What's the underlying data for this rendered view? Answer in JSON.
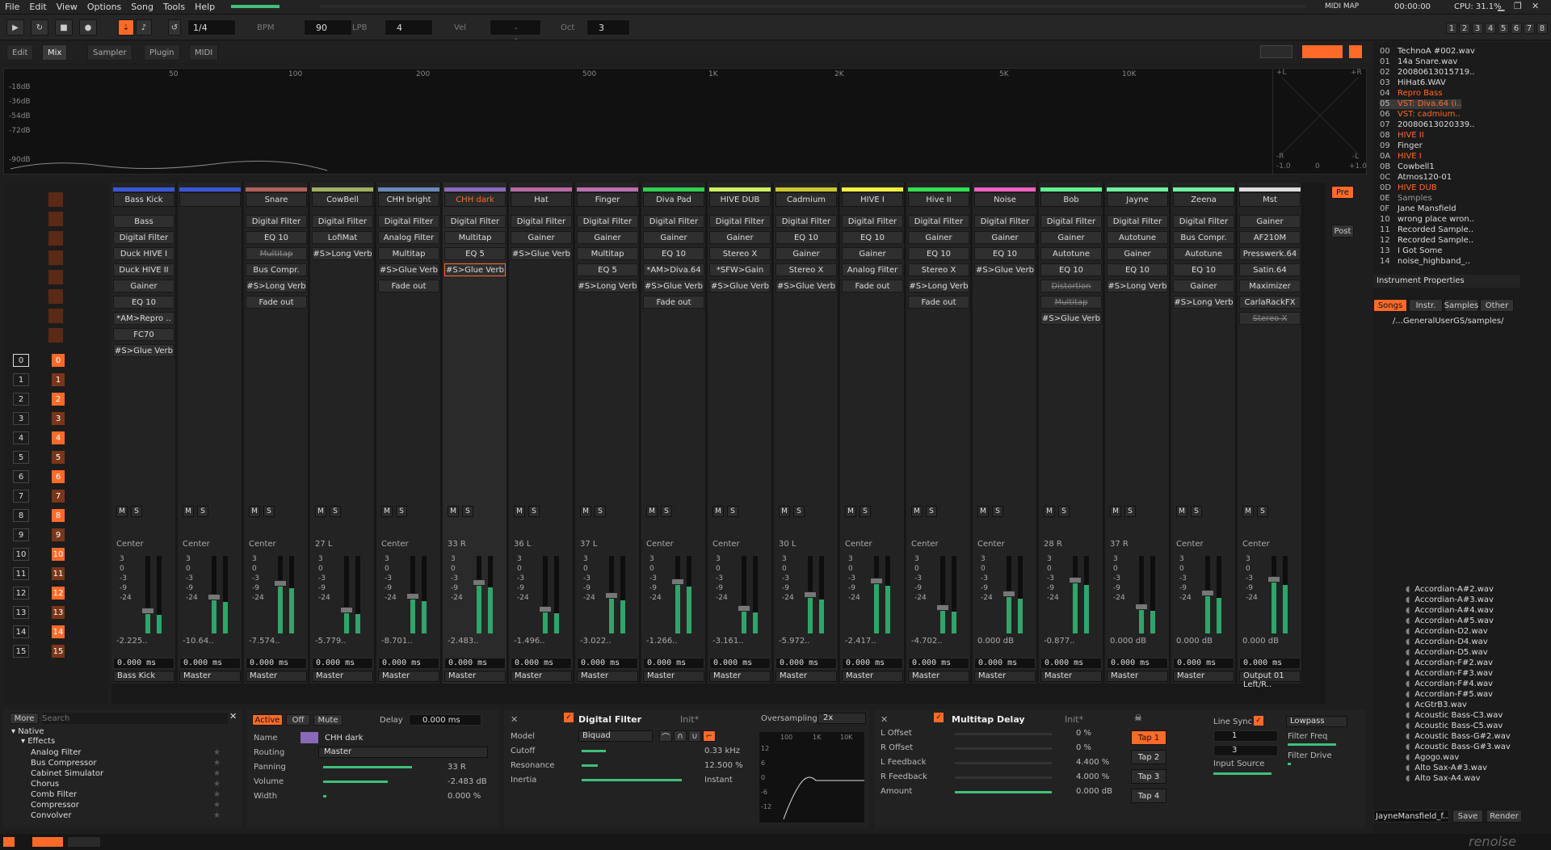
{
  "menu": [
    "File",
    "Edit",
    "View",
    "Options",
    "Song",
    "Tools",
    "Help"
  ],
  "status": {
    "midi_map": "MIDI MAP",
    "time": "00:00:00",
    "cpu": "CPU: 31.1%"
  },
  "transport": {
    "pattern": "1/4",
    "bpm_label": "BPM",
    "bpm": "90",
    "lpb_label": "LPB",
    "lpb": "4",
    "vel_label": "Vel",
    "vel": "--",
    "oct_label": "Oct",
    "oct": "3"
  },
  "tabs": {
    "edit": "Edit",
    "mix": "Mix",
    "sampler": "Sampler",
    "plugin": "Plugin",
    "midi": "MIDI"
  },
  "spectrum": {
    "db": [
      "-18dB",
      "-36dB",
      "-54dB",
      "-72dB",
      "-90dB"
    ],
    "freq": [
      "50",
      "100",
      "200",
      "500",
      "1K",
      "2K",
      "5K",
      "10K"
    ],
    "scope_left": "+L",
    "scope_right": "+R",
    "scope_r": "-R",
    "scope_l": "-L",
    "scope_min": "-1.0",
    "scope_zero": "0",
    "scope_max": "+1.0"
  },
  "mixer": {
    "strips": [
      {
        "name": "Bass Kick",
        "color": "#3a56d8",
        "devices": [
          "Bass",
          "Digital Filter",
          "Duck HIVE I",
          "Duck HIVE II",
          "Gainer",
          "EQ 10",
          "*AM>Repro ..",
          "FC70",
          "#S>Glue Verb"
        ],
        "pan": "Center",
        "vol": "-2.225..",
        "delay": "0.000 ms",
        "route": "Bass Kick"
      },
      {
        "name": "",
        "color": "#3a56d8",
        "devices": [],
        "pan": "Center",
        "vol": "-10.64..",
        "delay": "0.000 ms",
        "route": "Master"
      },
      {
        "name": "Snare",
        "color": "#b0605a",
        "devices": [
          "Digital Filter",
          "EQ 10",
          "Multitap",
          "Bus Compr.",
          "#S>Long Verb",
          "Fade out"
        ],
        "pan": "Center",
        "vol": "-7.574..",
        "delay": "0.000 ms",
        "route": "Master"
      },
      {
        "name": "CowBell",
        "color": "#a0b060",
        "devices": [
          "Digital Filter",
          "LofiMat",
          "#S>Long Verb"
        ],
        "pan": "27 L",
        "vol": "-5.779..",
        "delay": "0.000 ms",
        "route": "Master"
      },
      {
        "name": "CHH bright",
        "color": "#6a8ab8",
        "devices": [
          "Digital Filter",
          "Analog Filter",
          "Multitap",
          "#S>Glue Verb",
          "Fade out"
        ],
        "pan": "Center",
        "vol": "-8.701..",
        "delay": "0.000 ms",
        "route": "Master"
      },
      {
        "name": "CHH dark",
        "color": "#8a6ab8",
        "devices": [
          "Digital Filter",
          "Multitap",
          "EQ 5",
          "#S>Glue Verb"
        ],
        "pan": "33 R",
        "vol": "-2.483..",
        "delay": "0.000 ms",
        "route": "Master"
      },
      {
        "name": "Hat",
        "color": "#b86aa0",
        "devices": [
          "Digital Filter",
          "Gainer",
          "#S>Glue Verb"
        ],
        "pan": "36 L",
        "vol": "-1.496..",
        "delay": "0.000 ms",
        "route": "Master"
      },
      {
        "name": "Finger",
        "color": "#b870b0",
        "devices": [
          "Digital Filter",
          "Gainer",
          "Multitap",
          "EQ 5",
          "#S>Long Verb"
        ],
        "pan": "37 L",
        "vol": "-3.022..",
        "delay": "0.000 ms",
        "route": "Master"
      },
      {
        "name": "Diva Pad",
        "color": "#30d050",
        "devices": [
          "Digital Filter",
          "Gainer",
          "EQ 10",
          "*AM>Diva.64",
          "#S>Glue Verb",
          "Fade out"
        ],
        "pan": "Center",
        "vol": "-1.266..",
        "delay": "0.000 ms",
        "route": "Master"
      },
      {
        "name": "HIVE DUB",
        "color": "#d0f060",
        "devices": [
          "Digital Filter",
          "Gainer",
          "Stereo X",
          "*SFW>Gain",
          "#S>Glue Verb"
        ],
        "pan": "Center",
        "vol": "-3.161..",
        "delay": "0.000 ms",
        "route": "Master"
      },
      {
        "name": "Cadmium",
        "color": "#c8c830",
        "devices": [
          "Digital Filter",
          "EQ 10",
          "Gainer",
          "Stereo X",
          "#S>Glue Verb"
        ],
        "pan": "30 L",
        "vol": "-5.972..",
        "delay": "0.000 ms",
        "route": "Master"
      },
      {
        "name": "HIVE I",
        "color": "#f0f040",
        "devices": [
          "Digital Filter",
          "EQ 10",
          "Gainer",
          "Analog Filter",
          "Fade out"
        ],
        "pan": "Center",
        "vol": "-2.417..",
        "delay": "0.000 ms",
        "route": "Master"
      },
      {
        "name": "Hive II",
        "color": "#30e050",
        "devices": [
          "Digital Filter",
          "Gainer",
          "EQ 10",
          "Stereo X",
          "#S>Long Verb",
          "Fade out"
        ],
        "pan": "Center",
        "vol": "-4.702..",
        "delay": "0.000 ms",
        "route": "Master"
      },
      {
        "name": "Noise",
        "color": "#f060c0",
        "devices": [
          "Digital Filter",
          "Gainer",
          "EQ 10",
          "#S>Glue Verb"
        ],
        "pan": "Center",
        "vol": "0.000 dB",
        "delay": "0.000 ms",
        "route": "Master"
      },
      {
        "name": "Bob",
        "color": "#60f090",
        "devices": [
          "Digital Filter",
          "Gainer",
          "Autotune",
          "EQ 10",
          "Distortion",
          "Multitap",
          "#S>Glue Verb"
        ],
        "pan": "28 R",
        "vol": "-0.877..",
        "delay": "0.000 ms",
        "route": "Master"
      },
      {
        "name": "Jayne",
        "color": "#70f0a0",
        "devices": [
          "Digital Filter",
          "Autotune",
          "Gainer",
          "EQ 10",
          "#S>Long Verb"
        ],
        "pan": "37 R",
        "vol": "0.000 dB",
        "delay": "0.000 ms",
        "route": "Master"
      },
      {
        "name": "Zeena",
        "color": "#70f0a0",
        "devices": [
          "Digital Filter",
          "Bus Compr.",
          "Autotune",
          "EQ 10",
          "Gainer",
          "#S>Long Verb"
        ],
        "pan": "Center",
        "vol": "0.000 dB",
        "delay": "0.000 ms",
        "route": "Master"
      },
      {
        "name": "Mst",
        "color": "#dddddd",
        "devices": [
          "Gainer",
          "AF210M",
          "Presswerk.64",
          "Satin.64",
          "Maximizer",
          "CarlaRackFX",
          "Stereo X"
        ],
        "pan": "Center",
        "vol": "0.000 dB",
        "delay": "0.000 ms",
        "route": "Output 01 Left/R.."
      }
    ],
    "pre": "Pre",
    "post": "Post"
  },
  "tracknums": [
    "0",
    "1",
    "2",
    "3",
    "4",
    "5",
    "6",
    "7",
    "8",
    "9",
    "10",
    "11",
    "12",
    "13",
    "14",
    "15"
  ],
  "instruments": [
    {
      "n": "00",
      "name": "TechnoA #002.wav",
      "color": "#ddd"
    },
    {
      "n": "01",
      "name": "14a Snare.wav",
      "color": "#ddd"
    },
    {
      "n": "02",
      "name": "20080613015719..",
      "color": "#ddd"
    },
    {
      "n": "03",
      "name": "HiHat6.WAV",
      "color": "#ddd"
    },
    {
      "n": "04",
      "name": "Repro Bass",
      "color": "#ff6a28"
    },
    {
      "n": "05",
      "name": "VST: Diva.64 (i..",
      "color": "#ff6a28"
    },
    {
      "n": "06",
      "name": "VST: cadmium..",
      "color": "#ff6a28"
    },
    {
      "n": "07",
      "name": "20080613020339..",
      "color": "#ddd"
    },
    {
      "n": "08",
      "name": "HIVE II",
      "color": "#ff6a28"
    },
    {
      "n": "09",
      "name": "Finger",
      "color": "#ddd"
    },
    {
      "n": "0A",
      "name": "HIVE I",
      "color": "#ff6a28"
    },
    {
      "n": "0B",
      "name": "Cowbell1",
      "color": "#ddd"
    },
    {
      "n": "0C",
      "name": "Atmos120-01",
      "color": "#ddd"
    },
    {
      "n": "0D",
      "name": "HIVE DUB",
      "color": "#ff6a28"
    },
    {
      "n": "0E",
      "name": "Samples",
      "color": "#999"
    },
    {
      "n": "0F",
      "name": "Jane Mansfield",
      "color": "#ddd"
    },
    {
      "n": "10",
      "name": "wrong place wron..",
      "color": "#ddd"
    },
    {
      "n": "11",
      "name": "Recorded Sample..",
      "color": "#ddd"
    },
    {
      "n": "12",
      "name": "Recorded Sample..",
      "color": "#ddd"
    },
    {
      "n": "13",
      "name": "I Got Some",
      "color": "#ddd"
    },
    {
      "n": "14",
      "name": "noise_highband_..",
      "color": "#ddd"
    }
  ],
  "instrument_props": "Instrument Properties",
  "browser": {
    "tabs": [
      "Songs",
      "Instr.",
      "Samples",
      "Other"
    ],
    "path": "/...GeneralUserGS/samples/",
    "files": [
      "Accordian-A#2.wav",
      "Accordian-A#3.wav",
      "Accordian-A#4.wav",
      "Accordian-A#5.wav",
      "Accordian-D2.wav",
      "Accordian-D4.wav",
      "Accordian-D5.wav",
      "Accordian-F#2.wav",
      "Accordian-F#3.wav",
      "Accordian-F#4.wav",
      "Accordian-F#5.wav",
      "AcGtrB3.wav",
      "Acoustic Bass-C3.wav",
      "Acoustic Bass-C5.wav",
      "Acoustic Bass-G#2.wav",
      "Acoustic Bass-G#3.wav",
      "Agogo.wav",
      "Alto Sax-A#3.wav",
      "Alto Sax-A4.wav"
    ],
    "filename": "JayneMansfield_f..",
    "save": "Save",
    "render": "Render"
  },
  "dsp_list": {
    "more": "More",
    "search_placeholder": "Search",
    "root": "Native",
    "group": "Effects",
    "items": [
      "Analog Filter",
      "Bus Compressor",
      "Cabinet Simulator",
      "Chorus",
      "Comb Filter",
      "Compressor",
      "Convolver"
    ]
  },
  "track_props": {
    "active": "Active",
    "off": "Off",
    "mute": "Mute",
    "delay_label": "Delay",
    "delay": "0.000 ms",
    "name_label": "Name",
    "name": "CHH dark",
    "routing_label": "Routing",
    "routing": "Master",
    "panning_label": "Panning",
    "panning": "33 R",
    "volume_label": "Volume",
    "volume": "-2.483 dB",
    "width_label": "Width",
    "width": "0.000 %"
  },
  "digital_filter": {
    "title": "Digital Filter",
    "preset": "Init*",
    "oversampling_label": "Oversampling",
    "oversampling": "2x",
    "model_label": "Model",
    "model": "Biquad",
    "cutoff_label": "Cutoff",
    "cutoff": "0.33 kHz",
    "resonance_label": "Resonance",
    "resonance": "12.500 %",
    "inertia_label": "Inertia",
    "inertia": "Instant",
    "graph_x": [
      "100",
      "1K",
      "10K"
    ],
    "graph_y": [
      "12",
      "6",
      "0",
      "-6",
      "-12"
    ]
  },
  "multitap": {
    "title": "Multitap Delay",
    "preset": "Init*",
    "rows": [
      {
        "label": "L Offset",
        "value": "0 %"
      },
      {
        "label": "R Offset",
        "value": "0 %"
      },
      {
        "label": "L Feedback",
        "value": "4.400 %"
      },
      {
        "label": "R Feedback",
        "value": "4.000 %"
      },
      {
        "label": "Amount",
        "value": "0.000 dB"
      }
    ],
    "taps": [
      "Tap 1",
      "Tap 2",
      "Tap 3",
      "Tap 4"
    ],
    "line_sync": "Line Sync",
    "sync_1": "1",
    "sync_2": "3",
    "input_source": "Input Source",
    "filter_type": "Lowpass",
    "filter_freq": "Filter Freq",
    "filter_drive": "Filter Drive"
  },
  "logo": "renoise",
  "colors": {
    "accent": "#ff6a28",
    "meter": "#2fa56a",
    "bg": "#1e1e1e"
  }
}
